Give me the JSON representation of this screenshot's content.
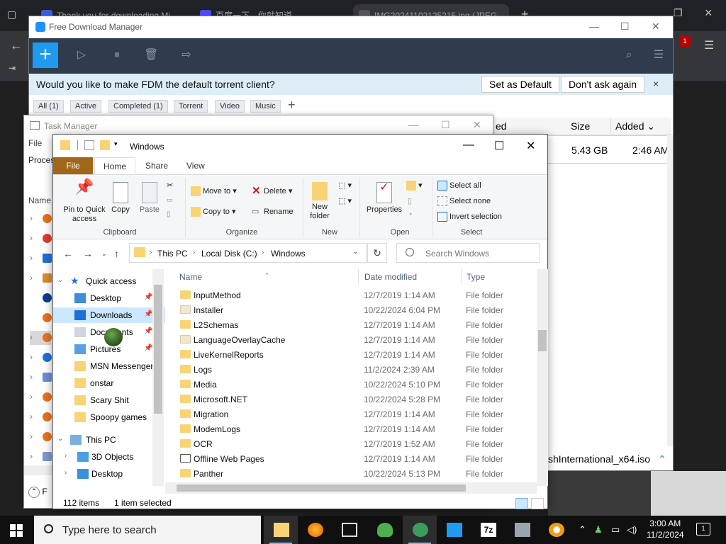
{
  "browser": {
    "tabs": [
      {
        "label": "Thank you for downloading Mi"
      },
      {
        "label": "百度一下，你就知道"
      },
      {
        "label": "IMG20241102125215.jpg (JPEG"
      }
    ],
    "tab_close": "×",
    "new_tab": "+",
    "ext_badge": "1"
  },
  "fdm": {
    "title": "Free Download Manager",
    "banner_text": "Would you like to make FDM the default torrent client?",
    "set_default": "Set as Default",
    "dont_ask": "Don't ask again",
    "close_banner": "×",
    "filters": [
      "All (1)",
      "Active",
      "Completed (1)",
      "Torrent",
      "Video",
      "Music"
    ],
    "add_filter": "+",
    "columns": {
      "added_partial": "ed",
      "size": "Size",
      "added": "Added"
    },
    "row": {
      "size": "5.43 GB",
      "added": "2:46 AM"
    },
    "bottom_file": "shInternational_x64.iso"
  },
  "task_manager": {
    "title": "Task Manager",
    "menu_file": "File",
    "tab_processes": "Proces",
    "col_name": "Name",
    "footer": "F"
  },
  "explorer": {
    "title": "Windows",
    "ribbon_tabs": {
      "file": "File",
      "home": "Home",
      "share": "Share",
      "view": "View"
    },
    "help": "?",
    "ribbon": {
      "pin": "Pin to Quick access",
      "copy": "Copy",
      "paste": "Paste",
      "clipboard": "Clipboard",
      "move_to": "Move to",
      "copy_to": "Copy to",
      "delete": "Delete",
      "rename": "Rename",
      "organize": "Organize",
      "new_folder": "New folder",
      "new": "New",
      "properties": "Properties",
      "open": "Open",
      "select_all": "Select all",
      "select_none": "Select none",
      "invert_selection": "Invert selection",
      "select": "Select"
    },
    "path": [
      "This PC",
      "Local Disk (C:)",
      "Windows"
    ],
    "search_placeholder": "Search Windows",
    "nav": [
      {
        "label": "Quick access",
        "kind": "quick",
        "pinned": false
      },
      {
        "label": "Desktop",
        "kind": "desktop",
        "pinned": true
      },
      {
        "label": "Downloads",
        "kind": "downloads",
        "pinned": true
      },
      {
        "label": "Documents",
        "kind": "documents",
        "pinned": true
      },
      {
        "label": "Pictures",
        "kind": "pictures",
        "pinned": true
      },
      {
        "label": "MSN Messenger",
        "kind": "folder",
        "pinned": false
      },
      {
        "label": "onstar",
        "kind": "folder",
        "pinned": false
      },
      {
        "label": "Scary Shit",
        "kind": "folder",
        "pinned": false
      },
      {
        "label": "Spoopy games",
        "kind": "folder",
        "pinned": false
      },
      {
        "label": "This PC",
        "kind": "pc",
        "pinned": false
      },
      {
        "label": "3D Objects",
        "kind": "3d",
        "pinned": false
      },
      {
        "label": "Desktop",
        "kind": "desktop",
        "pinned": false
      }
    ],
    "columns": {
      "name": "Name",
      "date": "Date modified",
      "type": "Type"
    },
    "files": [
      {
        "name": "InputMethod",
        "date": "12/7/2019 1:14 AM",
        "type": "File folder",
        "icon": "folder"
      },
      {
        "name": "Installer",
        "date": "10/22/2024 6:04 PM",
        "type": "File folder",
        "icon": "folder-light"
      },
      {
        "name": "L2Schemas",
        "date": "12/7/2019 1:14 AM",
        "type": "File folder",
        "icon": "folder"
      },
      {
        "name": "LanguageOverlayCache",
        "date": "12/7/2019 1:14 AM",
        "type": "File folder",
        "icon": "folder-light"
      },
      {
        "name": "LiveKernelReports",
        "date": "12/7/2019 1:14 AM",
        "type": "File folder",
        "icon": "folder"
      },
      {
        "name": "Logs",
        "date": "11/2/2024 2:39 AM",
        "type": "File folder",
        "icon": "folder"
      },
      {
        "name": "Media",
        "date": "10/22/2024 5:10 PM",
        "type": "File folder",
        "icon": "folder"
      },
      {
        "name": "Microsoft.NET",
        "date": "10/22/2024 5:28 PM",
        "type": "File folder",
        "icon": "folder"
      },
      {
        "name": "Migration",
        "date": "12/7/2019 1:14 AM",
        "type": "File folder",
        "icon": "folder"
      },
      {
        "name": "ModemLogs",
        "date": "12/7/2019 1:14 AM",
        "type": "File folder",
        "icon": "folder"
      },
      {
        "name": "OCR",
        "date": "12/7/2019 1:52 AM",
        "type": "File folder",
        "icon": "folder"
      },
      {
        "name": "Offline Web Pages",
        "date": "12/7/2019 1:14 AM",
        "type": "File folder",
        "icon": "web"
      },
      {
        "name": "Panther",
        "date": "10/22/2024 5:13 PM",
        "type": "File folder",
        "icon": "folder"
      }
    ],
    "status_items": "112 items",
    "status_selected": "1 item selected"
  },
  "taskbar": {
    "search_placeholder": "Type here to search",
    "time": "3:00 AM",
    "date": "11/2/2024",
    "notifications": "1",
    "zip_label": "7z"
  },
  "colors": {
    "fdm_toolbar": "#2f3c4d",
    "fdm_accent": "#1e9bf0",
    "ribbon_file_tab": "#a06718",
    "folder": "#f8d475",
    "selection": "#cce8ff",
    "taskbar": "#101010"
  }
}
